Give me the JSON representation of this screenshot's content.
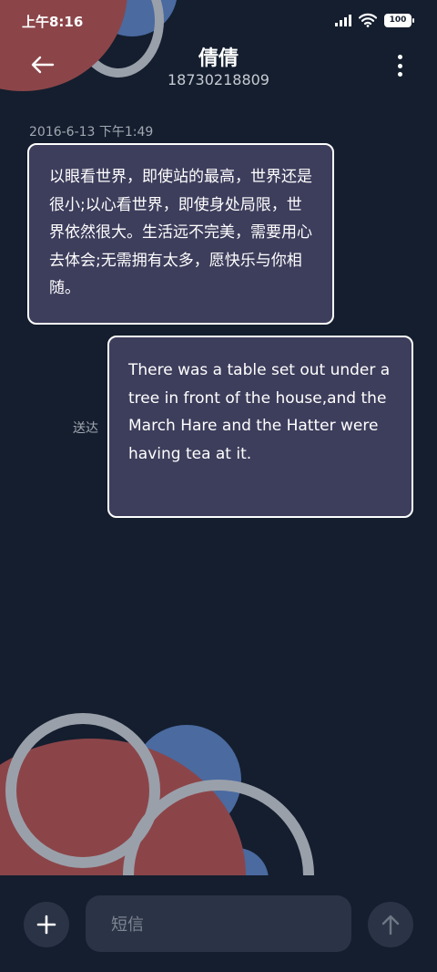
{
  "status_bar": {
    "time": "上午8:16",
    "battery": "100"
  },
  "header": {
    "contact_name": "倩倩",
    "contact_number": "18730218809"
  },
  "conversation": {
    "timestamp": "2016-6-13 下午1:49",
    "messages": [
      {
        "direction": "incoming",
        "text": "以眼看世界，即使站的最高，世界还是很小;以心看世界，即使身处局限，世界依然很大。生活远不完美，需要用心去体会;无需拥有太多，愿快乐与你相随。"
      },
      {
        "direction": "outgoing",
        "text": "There was a table set out under a tree in front of the house,and the March Hare and the Hatter were having tea at it.",
        "status": "送达"
      }
    ]
  },
  "composer": {
    "placeholder": "短信"
  },
  "icons": {
    "back": "arrow-left-icon",
    "more": "more-vertical-icon",
    "add": "plus-icon",
    "send": "arrow-up-icon"
  },
  "colors": {
    "background": "#141e2e",
    "bubble": "#3d3d5c",
    "accent_red": "#8b4549",
    "accent_blue": "#4a6aa0",
    "ring_gray": "#9aa0aa"
  }
}
